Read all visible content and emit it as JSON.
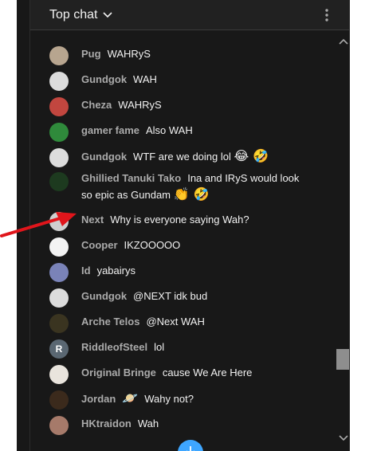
{
  "header": {
    "title": "Top chat"
  },
  "messages": [
    {
      "author": "Pug",
      "text": "WAHRyS",
      "avatar_color": "#b7a58f",
      "avatar_initial": ""
    },
    {
      "author": "Gundgok",
      "text": "WAH",
      "avatar_color": "#dcdcdc",
      "avatar_initial": ""
    },
    {
      "author": "Cheza",
      "text": "WAHRyS",
      "avatar_color": "#c2463f",
      "avatar_initial": ""
    },
    {
      "author": "gamer fame",
      "text": "Also WAH",
      "avatar_color": "#2f8a3b",
      "avatar_initial": ""
    },
    {
      "author": "Gundgok",
      "text": "WTF are we doing lol",
      "emoji": "😂 🤣",
      "avatar_color": "#dcdcdc",
      "avatar_initial": ""
    },
    {
      "author": "Ghillied Tanuki Tako",
      "text": "Ina and IRyS would look so epic as Gundam",
      "emoji": "👏 🤣",
      "avatar_color": "#1d3a1f",
      "avatar_initial": ""
    },
    {
      "author": "Next",
      "text": "Why is everyone saying Wah?",
      "avatar_color": "#cfcfcf",
      "avatar_initial": ""
    },
    {
      "author": "Cooper",
      "text": "IKZOOOOO",
      "avatar_color": "#f3f3f3",
      "avatar_initial": ""
    },
    {
      "author": "Id",
      "text": "yabairys",
      "avatar_color": "#7a83b8",
      "avatar_initial": ""
    },
    {
      "author": "Gundgok",
      "text": "@NEXT idk bud",
      "avatar_color": "#dcdcdc",
      "avatar_initial": ""
    },
    {
      "author": "Arche Telos",
      "text": "@Next WAH",
      "avatar_color": "#3a3420",
      "avatar_initial": ""
    },
    {
      "author": "RiddleofSteel",
      "text": "lol",
      "avatar_color": "#5a6772",
      "avatar_initial": "R"
    },
    {
      "author": "Original Bringe",
      "text": "cause We Are Here",
      "avatar_color": "#e9e4dd",
      "avatar_initial": ""
    },
    {
      "author": "Jordan",
      "text": "Wahy not?",
      "badge": "🪐",
      "avatar_color": "#3b2a1c",
      "avatar_initial": ""
    },
    {
      "author": "HKtraidon",
      "text": "Wah",
      "avatar_color": "#a67a6a",
      "avatar_initial": ""
    }
  ],
  "colors": {
    "accent": "#3ea6ff",
    "author": "#aaaaaa",
    "text": "#f1f1f1",
    "annotation": "#e0151b"
  },
  "icons": {
    "header": [
      "chevron-down-icon",
      "more-vert-icon"
    ],
    "scroll": [
      "scroll-up-icon",
      "scroll-down-icon"
    ],
    "jump": "arrow-down-icon"
  }
}
